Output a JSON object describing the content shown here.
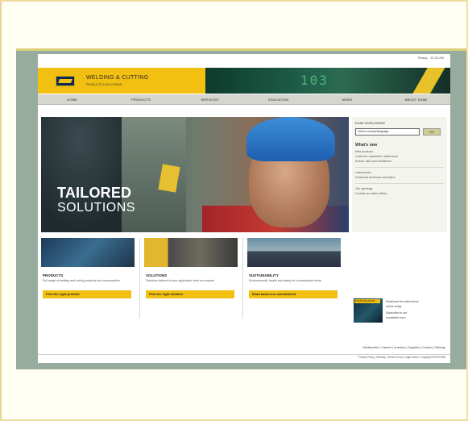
{
  "page": {
    "util_link": "Ready - 12:34 AM"
  },
  "brand": {
    "name": "WELDING & CUTTING",
    "tagline": "PRODUCTS & SOLUTIONS",
    "readout": "103"
  },
  "nav": [
    "HOME",
    "PRODUCTS",
    "SERVICES",
    "EDUCATION",
    "NEWS",
    "ABOUT ESAB"
  ],
  "hero": {
    "title": "TAILORED",
    "subtitle": "SOLUTIONS"
  },
  "sidebar": {
    "country_label": "ESAB WORLDWIDE",
    "country_select": "Select country/language",
    "go": "GO",
    "heading": "What's new",
    "lines": [
      "New products",
      "Customer newsletter: latest issue",
      "Events, fairs and exhibitions",
      "Latest press",
      "Download brochures and flyers",
      "Job openings",
      "Contact our sales offices"
    ]
  },
  "tiles": [
    {
      "heading": "PRODUCTS",
      "text": "Full range of welding and cutting products and consumables",
      "button": "Find the right product"
    },
    {
      "heading": "SOLUTIONS",
      "text": "Solutions tailored to your application from our experts",
      "button": "Find the right solution"
    },
    {
      "heading": "SUSTAINABILITY",
      "text": "Environmental, health and safety for a sustainable future",
      "button": "Read about our commitment"
    }
  ],
  "promo": {
    "tag": "ESAB MAGAZINE",
    "lines": [
      "Download the latest issue",
      "online today",
      "Subscribe to our",
      "newsletter here"
    ]
  },
  "links": "Mediacenter | Careers | Investors | Suppliers | Contact | Sitemap",
  "footer": "Privacy Policy | Sitemap | Terms of use | Legal notice | Copyright 2009 ESAB",
  "colors": {
    "accent": "#f2c010",
    "nav_bg": "#d6d6d0",
    "frame": "#fffef3",
    "site_bg": "#98ab9f"
  }
}
